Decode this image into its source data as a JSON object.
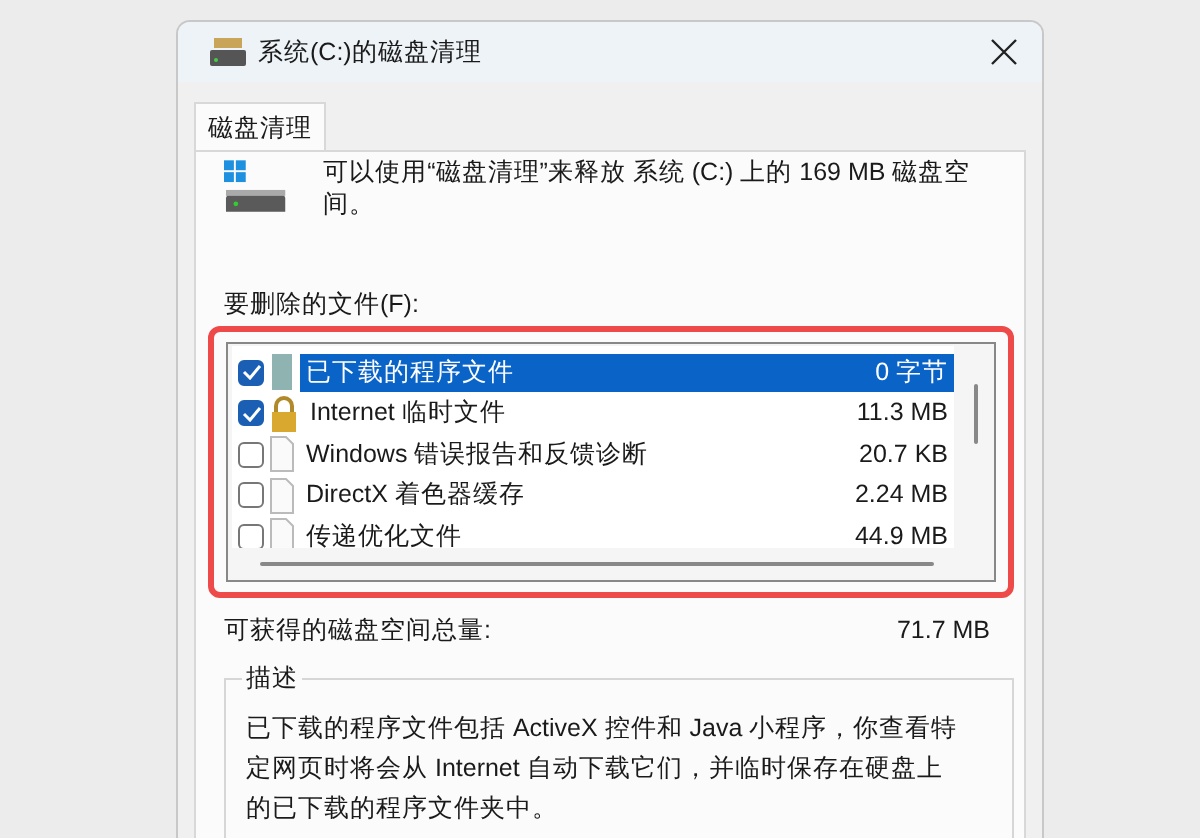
{
  "window": {
    "title": "系统(C:)的磁盘清理"
  },
  "tabs": [
    {
      "label": "磁盘清理",
      "selected": true
    }
  ],
  "intro": "可以使用“磁盘清理”来释放 系统 (C:) 上的 169 MB 磁盘空间。",
  "files_label": "要删除的文件(F):",
  "files": [
    {
      "kind": "program",
      "name": "已下载的程序文件",
      "size": "0 字节",
      "checked": true,
      "selected": true
    },
    {
      "kind": "locked",
      "name": "Internet 临时文件",
      "size": "11.3 MB",
      "checked": true,
      "selected": false
    },
    {
      "kind": "file",
      "name": "Windows 错误报告和反馈诊断",
      "size": "20.7 KB",
      "checked": false,
      "selected": false
    },
    {
      "kind": "file",
      "name": "DirectX 着色器缓存",
      "size": "2.24 MB",
      "checked": false,
      "selected": false
    },
    {
      "kind": "file",
      "name": "传递优化文件",
      "size": "44.9 MB",
      "checked": false,
      "selected": false
    }
  ],
  "total": {
    "label": "可获得的磁盘空间总量:",
    "value": "71.7 MB"
  },
  "description": {
    "title": "描述",
    "text": "已下载的程序文件包括 ActiveX 控件和 Java 小程序，你查看特定网页时将会从 Internet 自动下载它们，并临时保存在硬盘上的已下载的程序文件夹中。"
  }
}
